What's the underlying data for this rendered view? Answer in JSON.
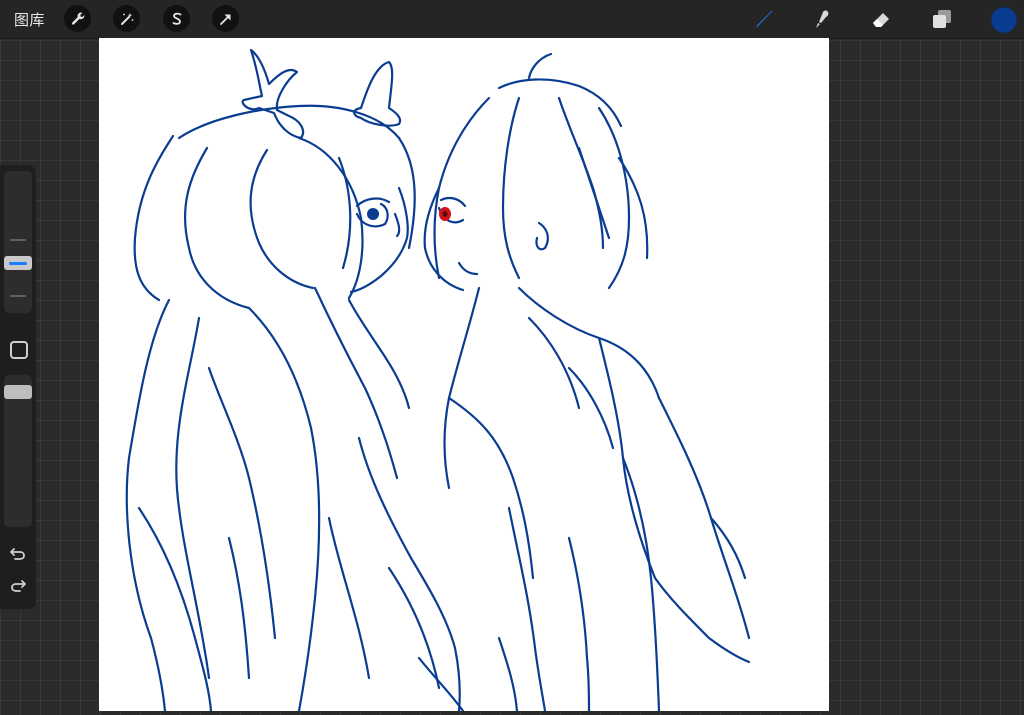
{
  "toolbar": {
    "gallery_label": "图库",
    "left_tools": [
      "wrench-icon",
      "magic-wand-icon",
      "selection-icon",
      "transform-arrow-icon"
    ],
    "right_tools": [
      "brush-icon",
      "smudge-icon",
      "eraser-icon",
      "layers-icon"
    ],
    "active_tool": "brush-icon",
    "current_color": "#0a3d91"
  },
  "canvas": {
    "background": "#ffffff",
    "stroke_color": "#0a3d91",
    "eye_accent_color": "#d4141c"
  },
  "sidebar": {
    "controls": [
      "brush-size-slider",
      "modify-button",
      "opacity-slider",
      "undo-icon",
      "redo-icon"
    ]
  }
}
